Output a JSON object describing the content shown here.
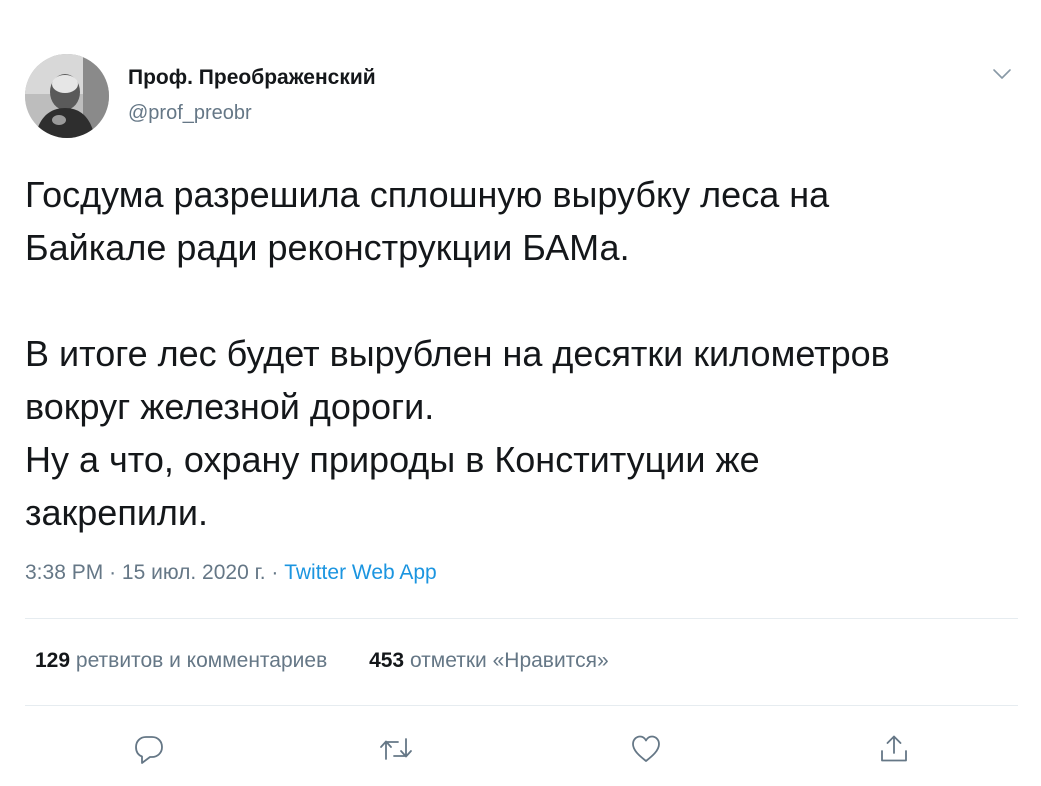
{
  "tweet": {
    "author": {
      "display_name": "Проф. Преображенский",
      "handle": "@prof_preobr"
    },
    "text_lines": [
      "Госдума разрешила сплошную вырубку леса на",
      "Байкале ради реконструкции БАМа.",
      "В итоге лес будет вырублен на десятки километров",
      "вокруг железной дороги.",
      "Ну а что, охрану природы в Конституции же",
      "закрепили."
    ],
    "time": "3:38 PM",
    "date": "15 июл. 2020 г.",
    "separator": "·",
    "source": "Twitter Web App",
    "retweets_count": "129",
    "retweets_label": "ретвитов и комментариев",
    "likes_count": "453",
    "likes_label": "отметки «Нравится»"
  },
  "icons": {
    "menu": "chevron-down-icon",
    "reply": "reply-icon",
    "retweet": "retweet-icon",
    "like": "heart-icon",
    "share": "share-icon"
  },
  "colors": {
    "text": "#14171a",
    "secondary": "#657786",
    "link": "#1b95e0",
    "divider": "#e6ecf0"
  }
}
